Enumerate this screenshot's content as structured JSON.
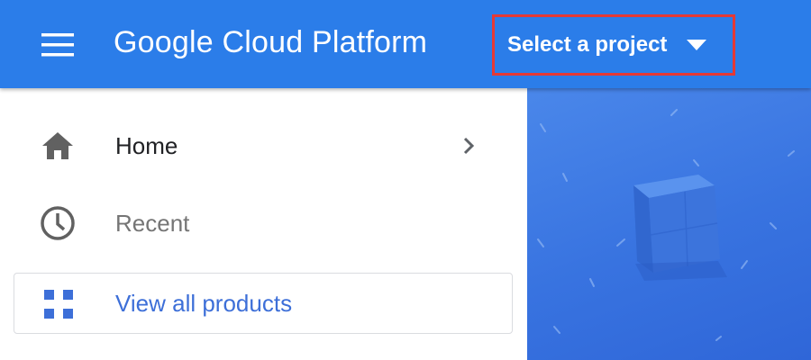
{
  "header": {
    "title": "Google Cloud Platform",
    "menu_icon": "hamburger-menu-icon",
    "project_selector": {
      "label": "Select a project",
      "icon": "caret-down-icon",
      "highlight_color": "#e53935"
    },
    "background_color": "#2b7de9"
  },
  "sidebar": {
    "items": [
      {
        "label": "Home",
        "icon": "home-icon",
        "trailing_icon": "chevron-right-icon"
      },
      {
        "label": "Recent",
        "icon": "clock-icon"
      }
    ],
    "products_button": {
      "label": "View all products",
      "icon": "grid-icon",
      "color": "#3d6fd8"
    }
  },
  "illustration": {
    "description_icon": "cube-illustration"
  }
}
